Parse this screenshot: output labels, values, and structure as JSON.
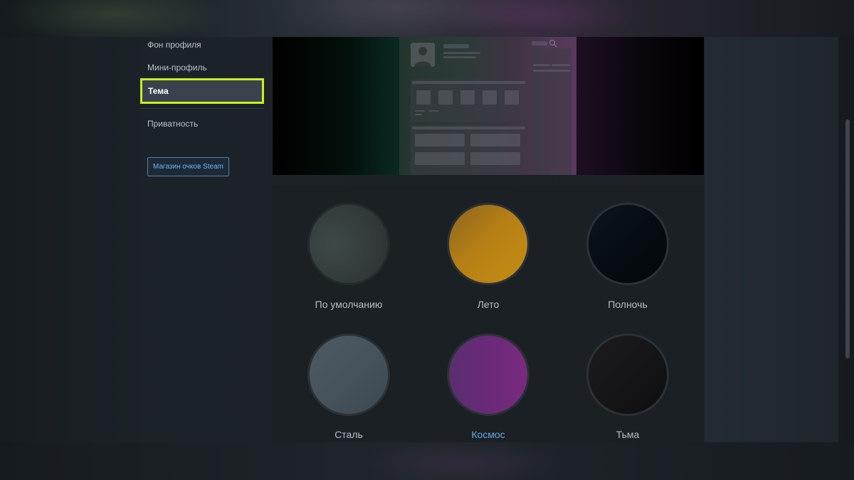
{
  "sidebar": {
    "items": [
      {
        "label": "Фон профиля"
      },
      {
        "label": "Мини-профиль"
      },
      {
        "label": "Тема",
        "active": true
      },
      {
        "label": "Приватность"
      }
    ],
    "shop_button": "Магазин очков Steam"
  },
  "preview": {
    "icons": [
      "avatar-icon",
      "search-icon"
    ]
  },
  "themes": [
    {
      "label": "По умолчанию",
      "color": "#3a4444",
      "selected": false
    },
    {
      "label": "Лето",
      "color": "#b57f15",
      "selected": false
    },
    {
      "label": "Полночь",
      "color": "#050b10",
      "selected": false
    },
    {
      "label": "Сталь",
      "color": "#46525c",
      "selected": false
    },
    {
      "label": "Космос",
      "color": "#6a2a78",
      "selected": true
    },
    {
      "label": "Тьма",
      "color": "#141416",
      "selected": false
    }
  ],
  "colors": {
    "accent_highlight": "#c7f01f",
    "link_blue": "#66a8e6"
  }
}
